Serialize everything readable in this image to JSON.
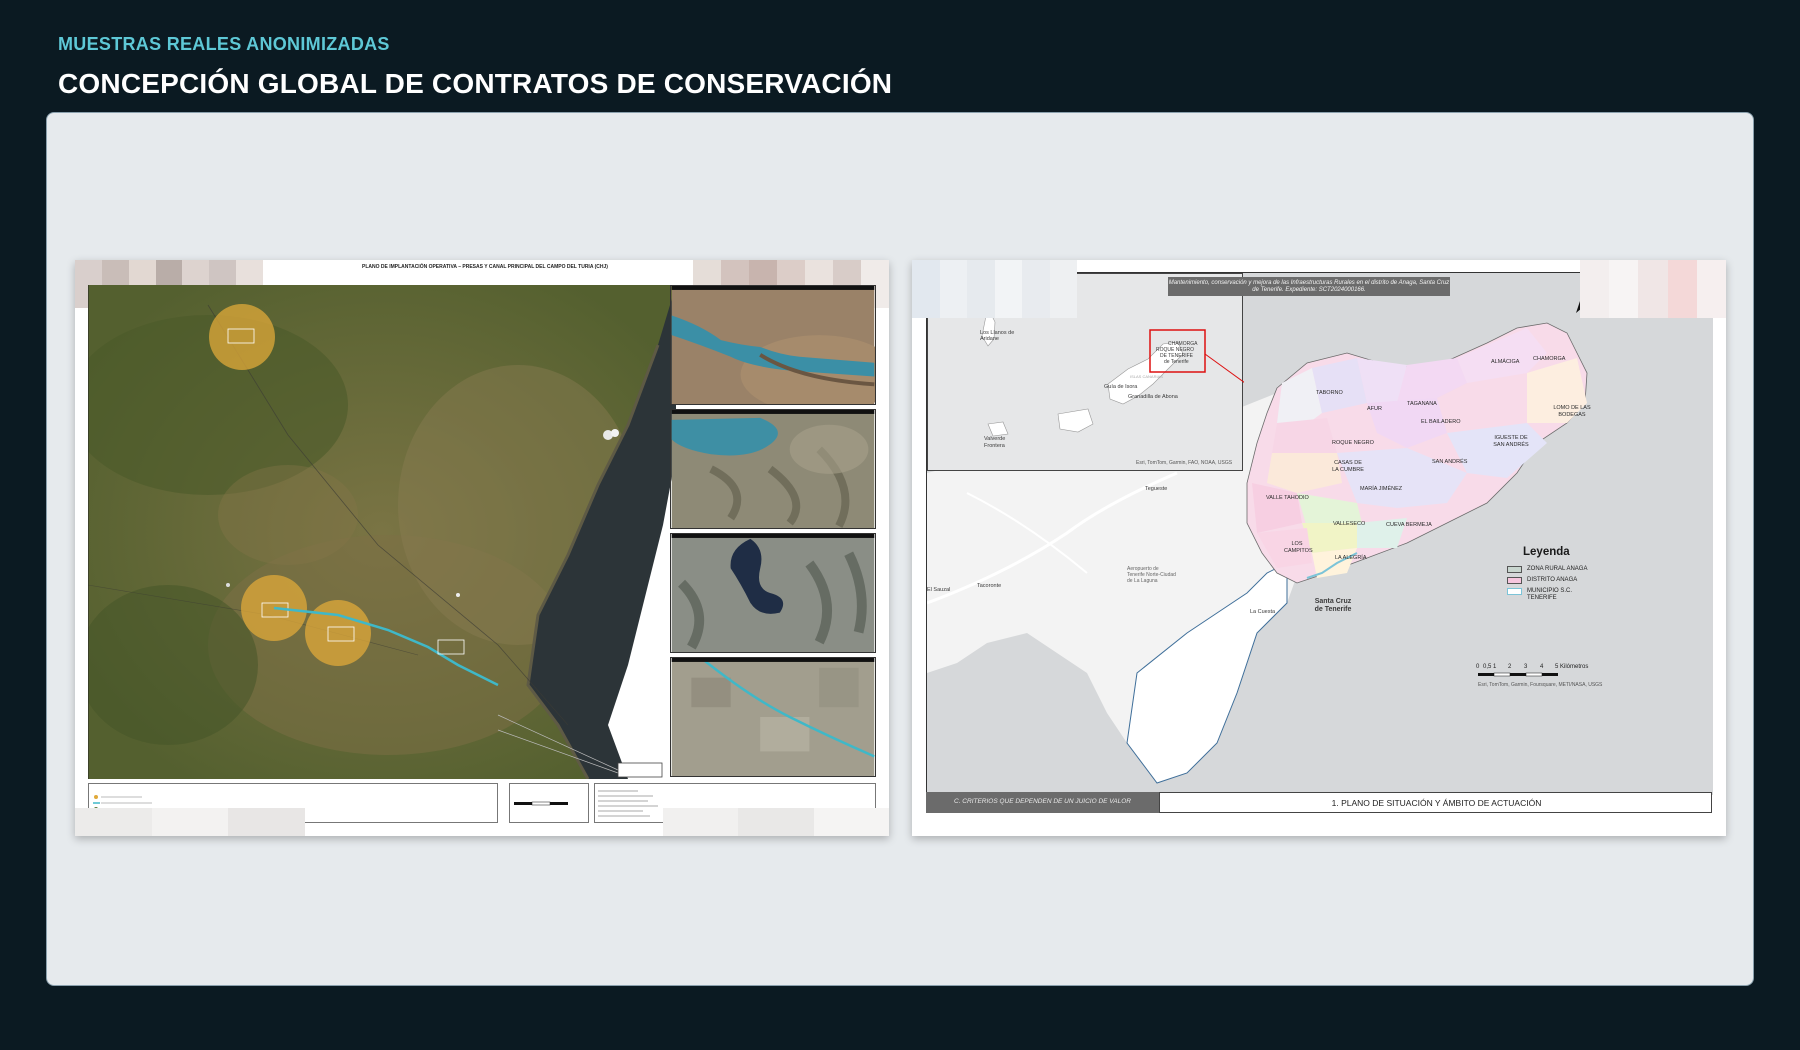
{
  "header": {
    "eyebrow": "MUESTRAS REALES ANONIMIZADAS",
    "title": "CONCEPCIÓN GLOBAL DE CONTRATOS DE CONSERVACIÓN"
  },
  "left_sheet": {
    "title": "PLANO DE IMPLANTACIÓN OPERATIVA – PRESAS Y CANAL PRINCIPAL DEL CAMPO DEL TURIA (CHJ)",
    "colors": {
      "satellite": "#5c6a3a",
      "sea": "#2b3338",
      "buffer": "#e0a93a",
      "canal": "#3fb8c8"
    }
  },
  "right_sheet": {
    "title": "Mantenimiento, conservación y mejora de las Infraestructuras Rurales en el distrito de Anaga, Santa Cruz de Tenerife. Expediente: SCT2024000166.",
    "inset": {
      "labels": [
        "Los Llanos de Aridane",
        "Guía de Isora",
        "ISLAS CANARIAS",
        "Granadilla de Abona",
        "Valverde",
        "Frontera",
        "CHAMORGA",
        "ROQUE NEGRO",
        "DE TENERIFE",
        "de Tenerife"
      ],
      "credit": "Esri, TomTom, Garmin, FAO, NOAA, USGS"
    },
    "place_labels": [
      "Tegueste",
      "Tacoronte",
      "El Sauzal",
      "Aeropuerto de Tenerife Norte-Ciudad de La Laguna",
      "La Cuesta",
      "Santa Cruz de Tenerife"
    ],
    "zones": [
      "CHAMORGA",
      "ALMÁCIGA",
      "TABORNO",
      "AFUR",
      "TAGANANA",
      "LOMO DE LAS BODEGAS",
      "EL BAILADERO",
      "ROQUE NEGRO",
      "IGUESTE DE SAN ANDRÉS",
      "CASAS DE LA CUMBRE",
      "SAN ANDRÉS",
      "VALLE TAHODIO",
      "MARÍA JIMÉNEZ",
      "VALLESECO",
      "CUEVA BERMEJA",
      "LOS CAMPITOS",
      "LA ALEGRÍA"
    ],
    "legend": {
      "title": "Leyenda",
      "items": [
        {
          "label": "ZONA RURAL ANAGA",
          "color": "#c9d6cf"
        },
        {
          "label": "DISTRITO ANAGA",
          "color": "#f6c6de"
        },
        {
          "label": "MUNICIPIO S.C. TENERIFE",
          "color": "#ffffff"
        }
      ]
    },
    "scale": {
      "ticks": [
        "0",
        "0,5",
        "1",
        "2",
        "3",
        "4",
        "5 Kilómetros"
      ]
    },
    "credit": "Esri, TomTom, Garmin, Foursquare, METI/NASA, USGS",
    "footer_left": "C. CRITERIOS QUE DEPENDEN DE UN JUICIO DE VALOR",
    "footer_right": "1. PLANO DE SITUACIÓN Y ÁMBITO DE ACTUACIÓN"
  }
}
